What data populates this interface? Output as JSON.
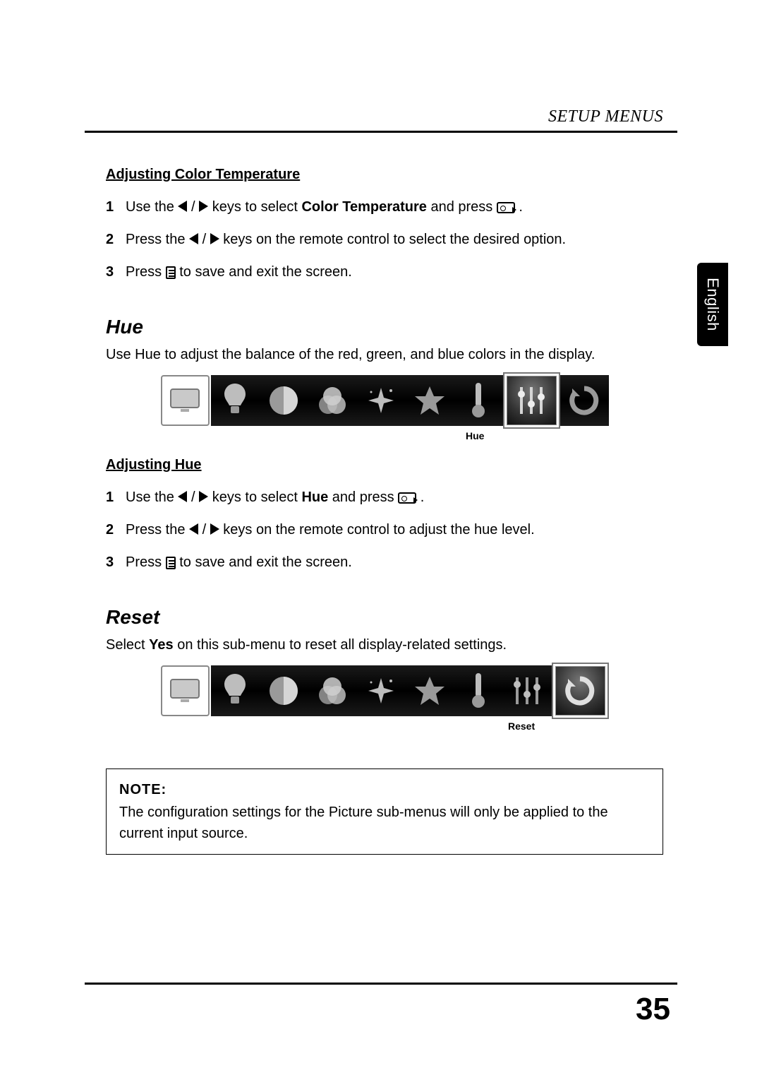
{
  "header": {
    "section_title": "SETUP MENUS"
  },
  "language_tab": "English",
  "page_number": "35",
  "section_color_temp": {
    "subheading": "Adjusting Color Temperature",
    "steps": [
      {
        "num": "1",
        "pre": "Use the ",
        "mid": " keys to select ",
        "bold": "Color Temperature",
        "post": " and press ",
        "end": "."
      },
      {
        "num": "2",
        "pre": "Press the ",
        "post": " keys on the remote control to select the desired option."
      },
      {
        "num": "3",
        "pre": "Press ",
        "post": " to save and exit the screen."
      }
    ]
  },
  "section_hue": {
    "heading": "Hue",
    "intro": "Use Hue to adjust the balance of the red, green, and blue colors in the display.",
    "strip_label": "Hue",
    "subheading": "Adjusting Hue",
    "steps": [
      {
        "num": "1",
        "pre": "Use the ",
        "mid": " keys to select ",
        "bold": "Hue",
        "post": " and press ",
        "end": "."
      },
      {
        "num": "2",
        "pre": "Press the ",
        "post": " keys on the remote control to adjust the hue level."
      },
      {
        "num": "3",
        "pre": "Press ",
        "post": " to save and exit the screen."
      }
    ]
  },
  "section_reset": {
    "heading": "Reset",
    "intro_pre": "Select ",
    "intro_bold": "Yes",
    "intro_post": " on this sub-menu to reset all display-related settings.",
    "strip_label": "Reset"
  },
  "note": {
    "label": "NOTE:",
    "text": "The configuration settings for the Picture sub-menus will only be applied to the current input source."
  },
  "icons": [
    "monitor",
    "bulb",
    "contrast",
    "rgb",
    "sparkle",
    "star",
    "thermometer",
    "sliders",
    "reset"
  ]
}
